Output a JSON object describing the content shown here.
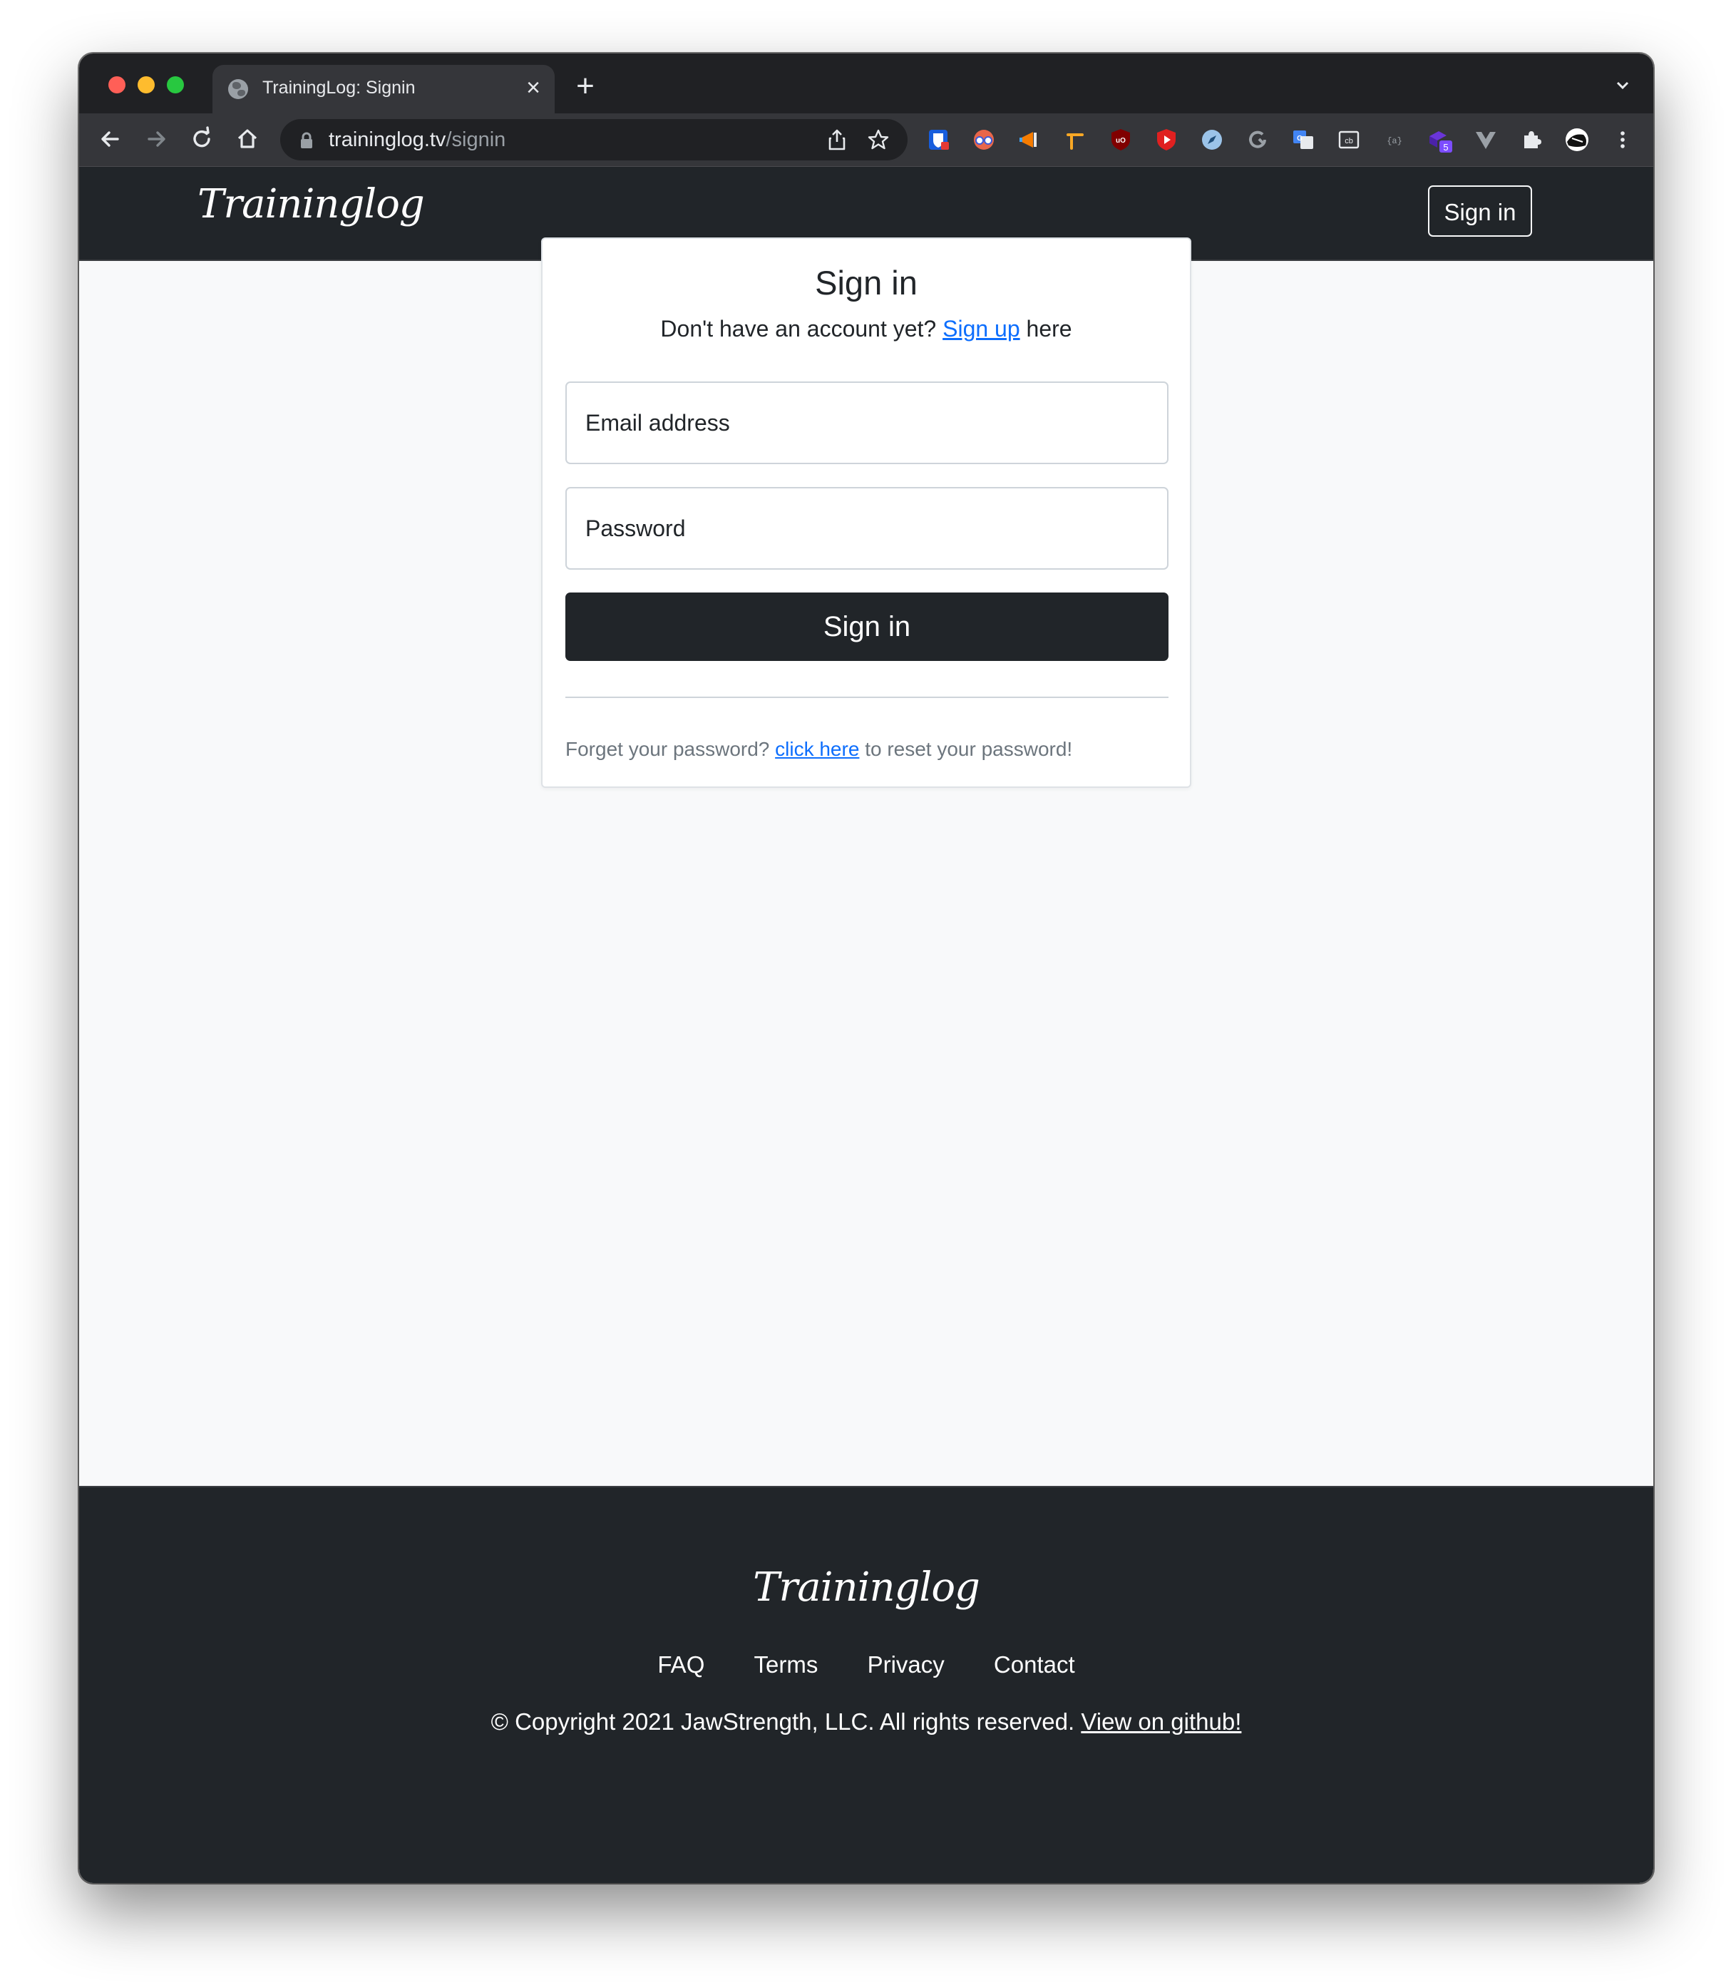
{
  "browser": {
    "tab_title": "TrainingLog: Signin",
    "url_host": "traininglog.tv",
    "url_path": "/signin",
    "extension_badge": "5"
  },
  "navbar": {
    "brand": "Traininglog",
    "signin_label": "Sign in"
  },
  "signin_card": {
    "title": "Sign in",
    "prompt": "Don't have an account yet?",
    "signup_link": "Sign up",
    "prompt_suffix": "here",
    "email_placeholder": "Email address",
    "password_placeholder": "Password",
    "submit_label": "Sign in",
    "forgot_prefix": "Forget your password?",
    "forgot_link": "click here",
    "forgot_suffix": "to reset your password!"
  },
  "footer": {
    "brand": "Traininglog",
    "links": [
      "FAQ",
      "Terms",
      "Privacy",
      "Contact"
    ],
    "copyright": "© Copyright 2021 JawStrength, LLC. All rights reserved.",
    "github_link": "View on github!"
  },
  "colors": {
    "dark": "#212529",
    "link": "#0d6efd",
    "page_bg": "#f8f9fa"
  }
}
